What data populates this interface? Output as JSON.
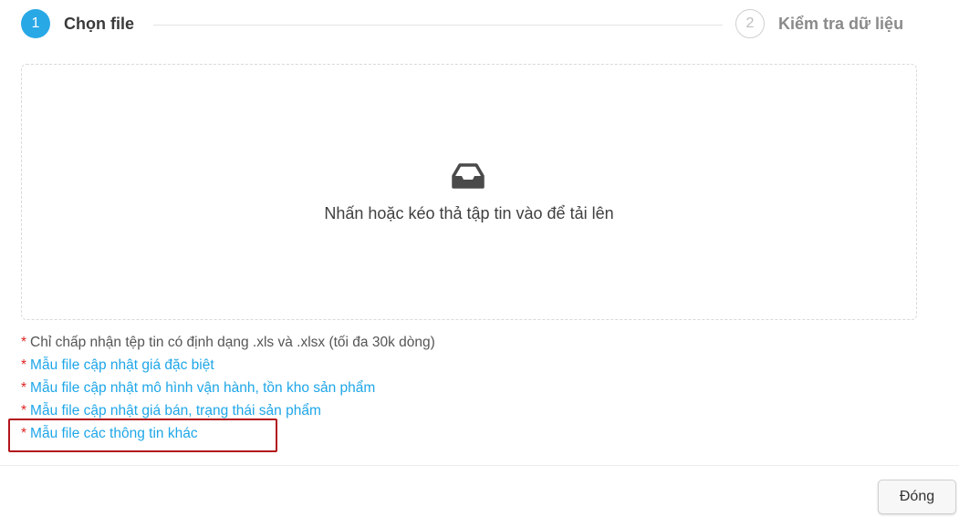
{
  "steps": [
    {
      "number": "1",
      "title": "Chọn file",
      "state": "active"
    },
    {
      "number": "2",
      "title": "Kiểm tra dữ liệu",
      "state": "inactive"
    }
  ],
  "upload": {
    "icon": "inbox-icon",
    "text": "Nhấn hoặc kéo thả tập tin vào để tải lên"
  },
  "notes": [
    {
      "marker": "*",
      "text": "Chỉ chấp nhận tệp tin có định dạng .xls và .xlsx (tối đa 30k dòng)",
      "type": "info"
    },
    {
      "marker": "*",
      "text": "Mẫu file cập nhật giá đặc biệt",
      "type": "link"
    },
    {
      "marker": "*",
      "text": "Mẫu file cập nhật mô hình vận hành, tồn kho sản phẩm",
      "type": "link"
    },
    {
      "marker": "*",
      "text": "Mẫu file cập nhật giá bán, trạng thái sản phẩm",
      "type": "link"
    },
    {
      "marker": "*",
      "text": "Mẫu file các thông tin khác",
      "type": "link",
      "highlighted": true
    }
  ],
  "footer": {
    "close_label": "Đóng"
  },
  "colors": {
    "accent": "#29a8e6",
    "link": "#1ea6e8",
    "required_marker": "#e02424",
    "highlight_border": "#b3141b"
  }
}
